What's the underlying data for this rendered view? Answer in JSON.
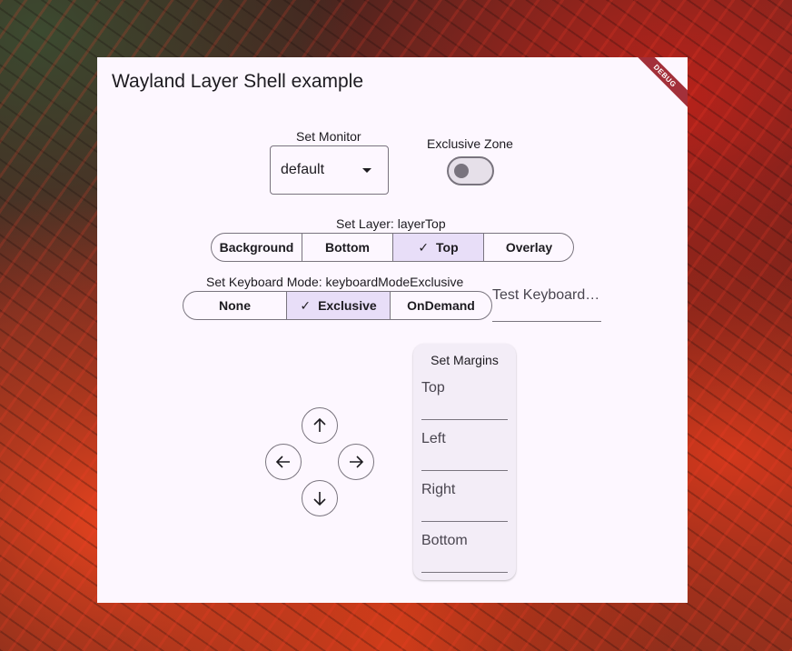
{
  "app": {
    "title": "Wayland Layer Shell example",
    "debug_banner": "DEBUG"
  },
  "monitor": {
    "label": "Set Monitor",
    "value": "default"
  },
  "exclusive_zone": {
    "label": "Exclusive Zone",
    "enabled": false
  },
  "layer": {
    "label": "Set Layer: layerTop",
    "options": [
      "Background",
      "Bottom",
      "Top",
      "Overlay"
    ],
    "selected": "Top"
  },
  "keyboard_mode": {
    "label": "Set Keyboard Mode: keyboardModeExclusive",
    "options": [
      "None",
      "Exclusive",
      "OnDemand"
    ],
    "selected": "Exclusive",
    "test_placeholder": "Test Keyboard…"
  },
  "direction_pad": {
    "icons": [
      "arrow-up-icon",
      "arrow-left-icon",
      "arrow-right-icon",
      "arrow-down-icon"
    ]
  },
  "margins": {
    "title": "Set Margins",
    "fields": [
      {
        "placeholder": "Top",
        "value": ""
      },
      {
        "placeholder": "Left",
        "value": ""
      },
      {
        "placeholder": "Right",
        "value": ""
      },
      {
        "placeholder": "Bottom",
        "value": ""
      }
    ]
  },
  "colors": {
    "surface": "#fdf7ff",
    "outline": "#79747e",
    "selected_segment": "#e8def8",
    "card": "#f3edf7",
    "debug_banner": "#a3303a"
  }
}
